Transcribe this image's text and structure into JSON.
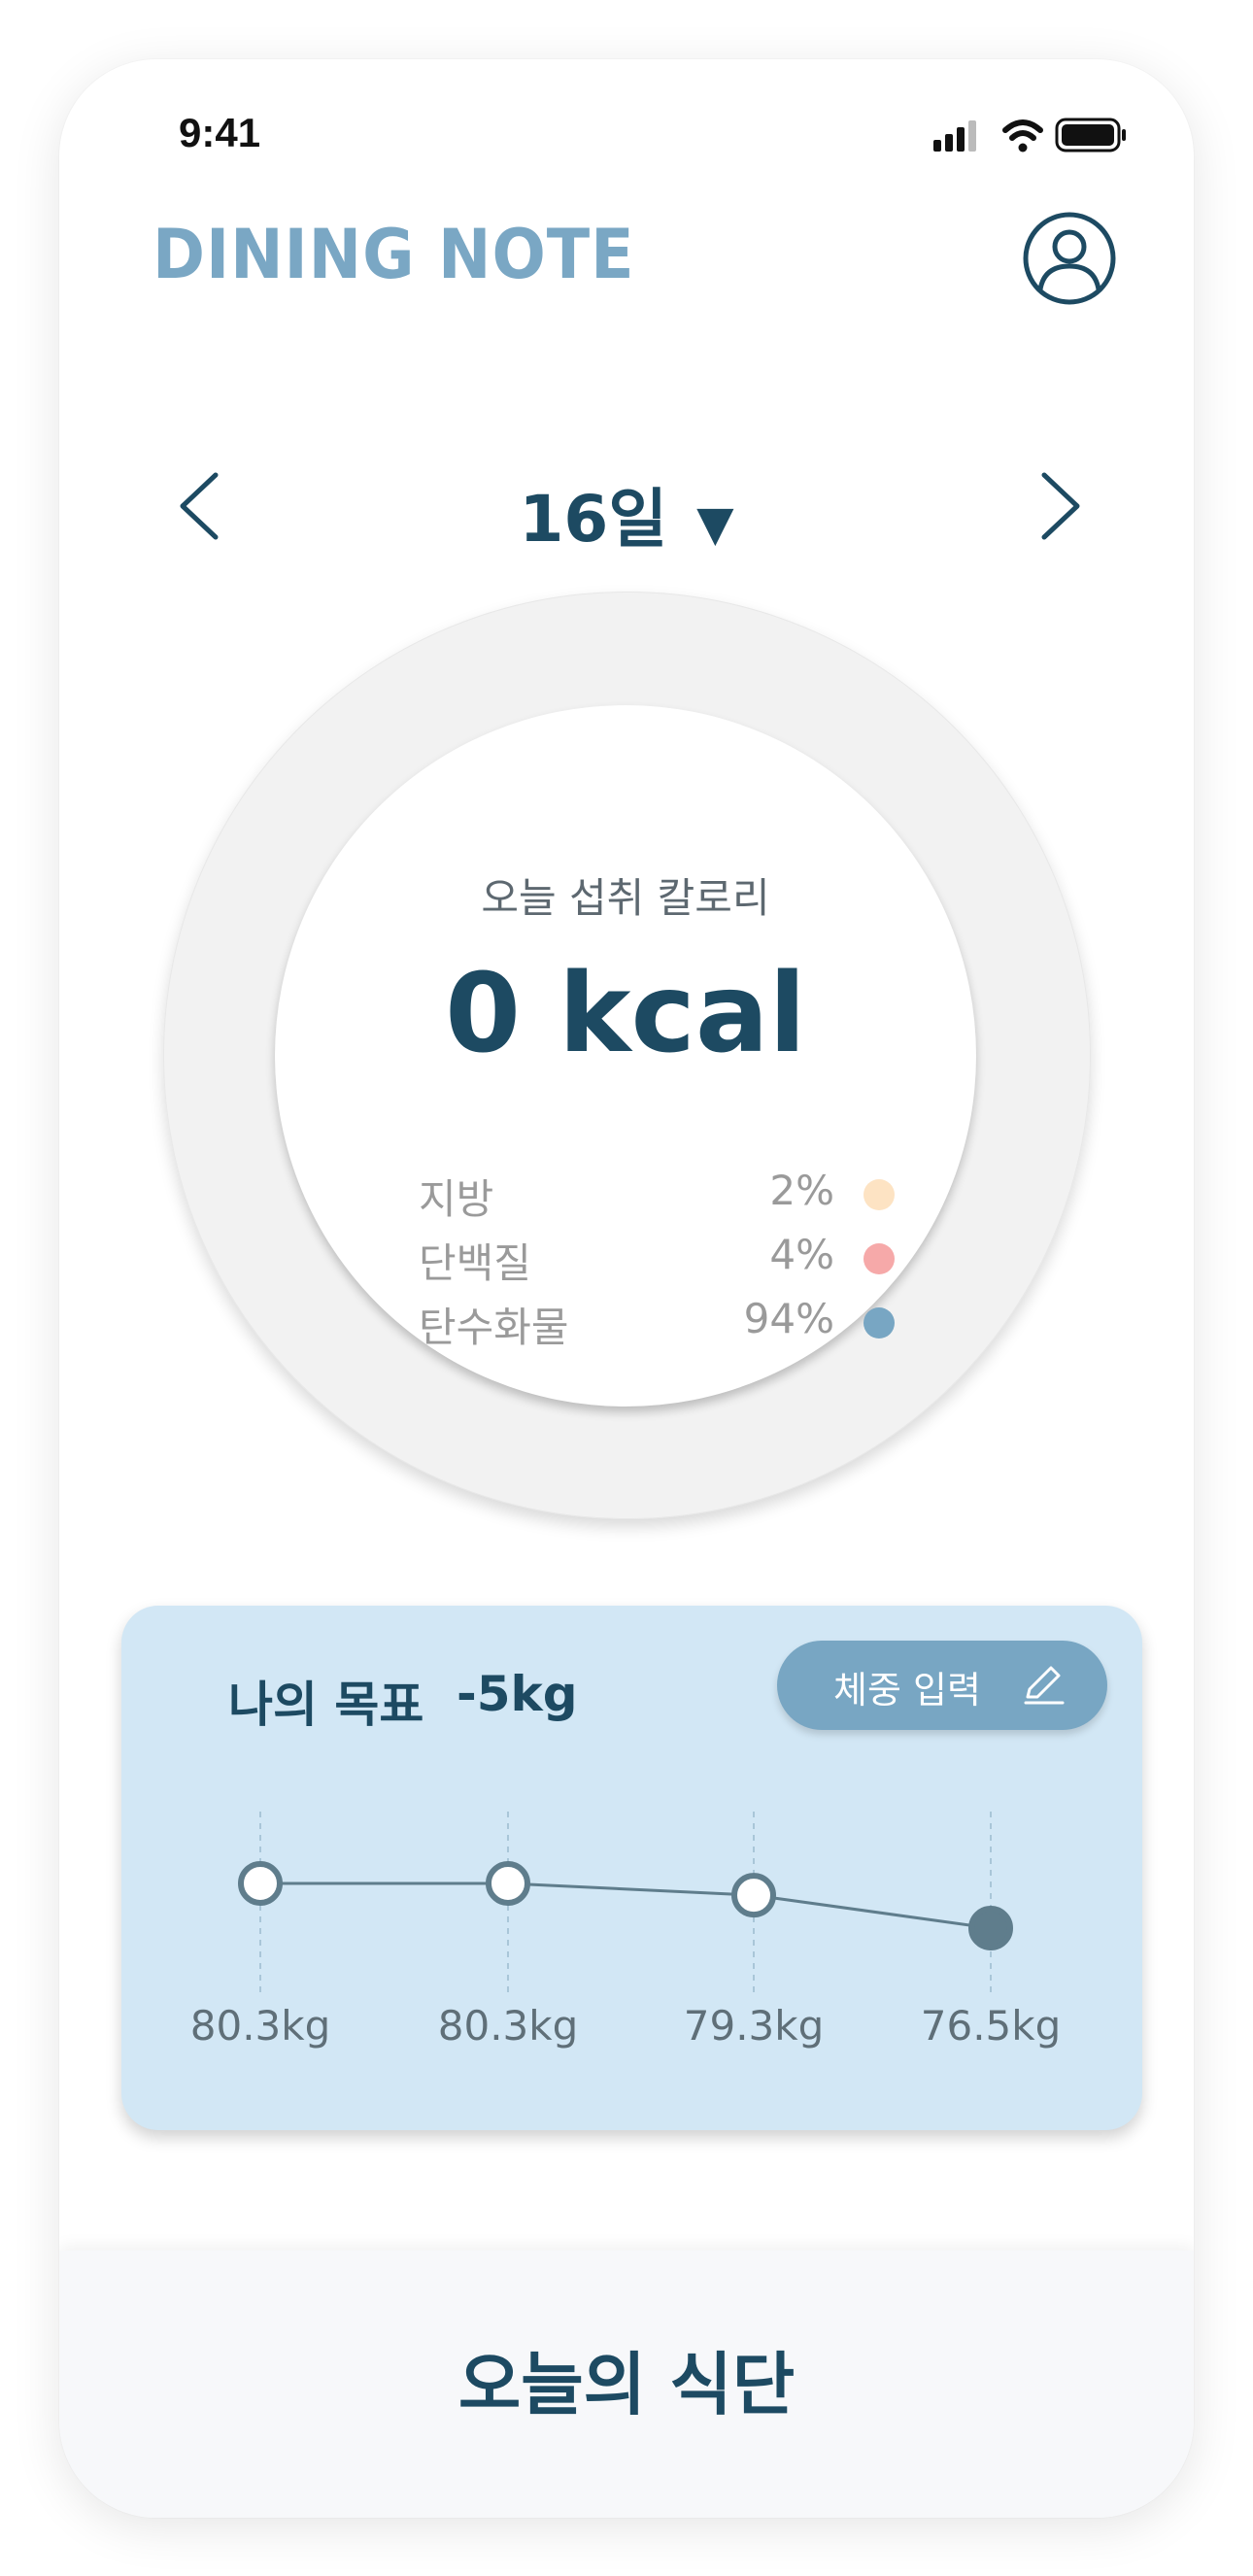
{
  "status_bar": {
    "time": "9:41",
    "icons": [
      "signal-icon",
      "wifi-icon",
      "battery-icon"
    ]
  },
  "header": {
    "logo": "DINING NOTE",
    "profile_icon": "user-profile-icon"
  },
  "date_nav": {
    "label": "16일",
    "prev_icon": "chevron-left-icon",
    "next_icon": "chevron-right-icon",
    "dropdown_icon": "caret-down-icon"
  },
  "calories": {
    "caption": "오늘 섭취 칼로리",
    "value": "0 kcal",
    "macros": [
      {
        "name": "지방",
        "percent": "2%",
        "color": "#fde3c3"
      },
      {
        "name": "단백질",
        "percent": "4%",
        "color": "#f6a9a9"
      },
      {
        "name": "탄수화물",
        "percent": "94%",
        "color": "#78a6c3"
      }
    ]
  },
  "goal": {
    "label": "나의 목표",
    "value": "-5kg",
    "button_label": "체중 입력",
    "button_icon": "pencil-icon"
  },
  "chart_data": {
    "type": "line",
    "x": [
      1,
      2,
      3,
      4
    ],
    "series": [
      {
        "values": [
          80.3,
          80.3,
          79.3,
          76.5
        ]
      }
    ],
    "labels": [
      "80.3kg",
      "80.3kg",
      "79.3kg",
      "76.5kg"
    ],
    "ylim": [
      76.5,
      80.3
    ],
    "grid": "vertical dashed",
    "last_point_filled": true
  },
  "bottom": {
    "title": "오늘의 식단"
  },
  "colors": {
    "primary": "#1d4a62",
    "accent": "#78a6c3",
    "card_bg": "#d2e7f5",
    "logo": "#7aa7c4"
  }
}
